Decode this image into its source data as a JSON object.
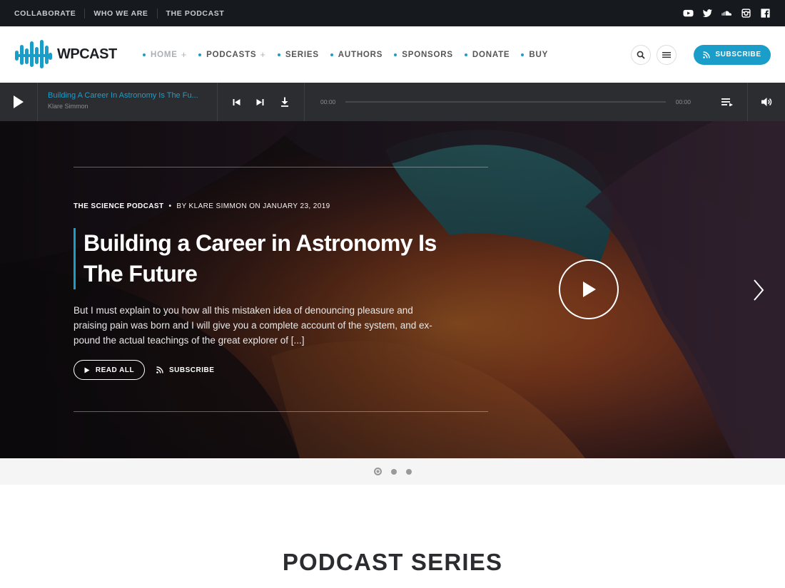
{
  "topbar": {
    "links": [
      "COLLABORATE",
      "WHO WE ARE",
      "THE PODCAST"
    ],
    "social_icons": [
      "youtube-icon",
      "twitter-icon",
      "soundcloud-icon",
      "instagram-icon",
      "facebook-icon"
    ]
  },
  "header": {
    "logo_text": "WPCAST",
    "nav": [
      {
        "label": "HOME",
        "has_submenu": true,
        "active": true
      },
      {
        "label": "PODCASTS",
        "has_submenu": true,
        "active": false
      },
      {
        "label": "SERIES",
        "has_submenu": false,
        "active": false
      },
      {
        "label": "AUTHORS",
        "has_submenu": false,
        "active": false
      },
      {
        "label": "SPONSORS",
        "has_submenu": false,
        "active": false
      },
      {
        "label": "DONATE",
        "has_submenu": false,
        "active": false
      },
      {
        "label": "BUY",
        "has_submenu": false,
        "active": false
      }
    ],
    "subscribe_label": "SUBSCRIBE",
    "accent_color": "#1a9ec9"
  },
  "player": {
    "track_title": "Building A Career In Astronomy Is The Fu...",
    "track_author": "Klare Simmon",
    "time_current": "00:00",
    "time_total": "00:00",
    "progress": 0
  },
  "hero": {
    "category": "THE SCIENCE PODCAST",
    "byline": "BY KLARE SIMMON ON JANUARY 23, 2019",
    "title_line1": "Building a Career in Astronomy Is",
    "title_line2": "The Future",
    "excerpt_line1": "But I must explain to you how all this mistaken idea of denouncing pleasure and",
    "excerpt_line2": "praising pain was born and I will give you a complete account of the system, and ex-",
    "excerpt_line3": "pound the actual teachings of the great explorer of [...]",
    "read_all_label": "READ ALL",
    "subscribe_label": "SUBSCRIBE"
  },
  "slider": {
    "count": 3,
    "active_index": 0
  },
  "section": {
    "title": "PODCAST SERIES"
  }
}
